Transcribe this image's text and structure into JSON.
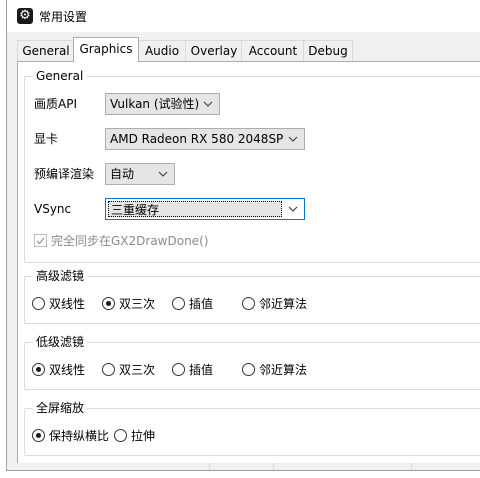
{
  "window": {
    "title": "常用设置",
    "icon": "gear-icon"
  },
  "tabs": [
    {
      "label": "General",
      "active": false
    },
    {
      "label": "Graphics",
      "active": true
    },
    {
      "label": "Audio",
      "active": false
    },
    {
      "label": "Overlay",
      "active": false
    },
    {
      "label": "Account",
      "active": false
    },
    {
      "label": "Debug",
      "active": false
    }
  ],
  "general": {
    "title": "General",
    "api_label": "画质API",
    "api_value": "Vulkan (试验性)",
    "gpu_label": "显卡",
    "gpu_value": "AMD Radeon RX 580 2048SP",
    "precompile_label": "预编译渲染",
    "precompile_value": "自动",
    "vsync_label": "VSync",
    "vsync_value": "三重缓存",
    "sync_checkbox_label": "完全同步在GX2DrawDone()",
    "sync_checkbox_checked": true
  },
  "upscale": {
    "title": "高级滤镜",
    "options": [
      "双线性",
      "双三次",
      "插值",
      "邻近算法"
    ],
    "selected": "双三次"
  },
  "downscale": {
    "title": "低级滤镜",
    "options": [
      "双线性",
      "双三次",
      "插值",
      "邻近算法"
    ],
    "selected": "双线性"
  },
  "fullscreen": {
    "title": "全屏缩放",
    "options": [
      "保持纵横比",
      "拉伸"
    ],
    "selected": "保持纵横比"
  },
  "colors": {
    "window_bg": "#f0f0f0",
    "panel_bg": "#ffffff",
    "border": "#adadad"
  }
}
